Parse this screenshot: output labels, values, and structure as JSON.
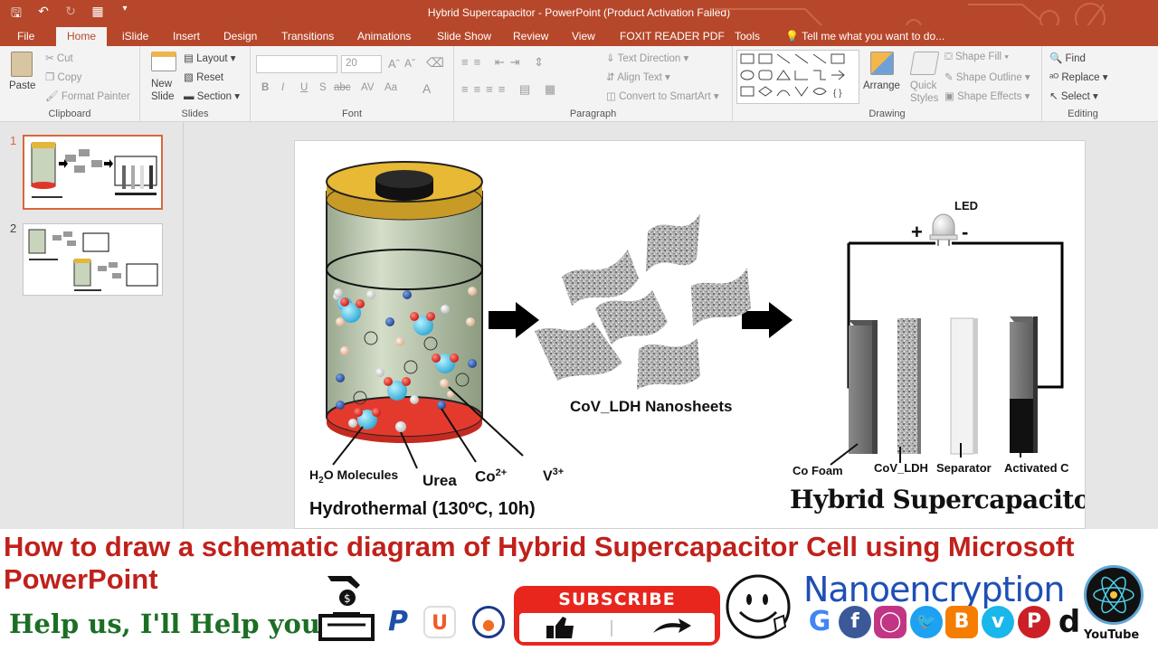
{
  "window": {
    "title": "Hybrid Supercapacitor - PowerPoint (Product Activation Failed)"
  },
  "tabs": [
    {
      "label": "File"
    },
    {
      "label": "Home"
    },
    {
      "label": "iSlide"
    },
    {
      "label": "Insert"
    },
    {
      "label": "Design"
    },
    {
      "label": "Transitions"
    },
    {
      "label": "Animations"
    },
    {
      "label": "Slide Show"
    },
    {
      "label": "Review"
    },
    {
      "label": "View"
    },
    {
      "label": "FOXIT READER PDF"
    },
    {
      "label": "Tools"
    }
  ],
  "tell_me": "Tell me what you want to do...",
  "ribbon": {
    "clipboard": {
      "paste": "Paste",
      "cut": "Cut",
      "copy": "Copy",
      "format_painter": "Format Painter",
      "label": "Clipboard"
    },
    "slides": {
      "new_slide": "New",
      "new_slide2": "Slide",
      "layout": "Layout",
      "reset": "Reset",
      "section": "Section",
      "label": "Slides"
    },
    "font": {
      "font_name": "",
      "font_size": "20",
      "label": "Font",
      "bold": "B",
      "italic": "I",
      "underline": "U",
      "strike": "S",
      "abc": "abc",
      "av": "AV",
      "aa": "Aa",
      "color": "A"
    },
    "paragraph": {
      "text_direction": "Text Direction",
      "align_text": "Align Text",
      "convert_smartart": "Convert to SmartArt",
      "label": "Paragraph"
    },
    "drawing": {
      "arrange": "Arrange",
      "quick_styles": "Quick",
      "quick_styles2": "Styles",
      "shape_fill": "Shape Fill",
      "shape_outline": "Shape Outline",
      "shape_effects": "Shape Effects",
      "label": "Drawing"
    },
    "editing": {
      "find": "Find",
      "replace": "Replace",
      "select": "Select",
      "label": "Editing"
    }
  },
  "thumbnails": [
    {
      "number": "1"
    },
    {
      "number": "2"
    }
  ],
  "slide": {
    "led": "LED",
    "plus": "+",
    "minus": "-",
    "nanosheets": "CoV_LDH Nanosheets",
    "h2o": "H",
    "h2o_sub": "2",
    "h2o_rest": "O Molecules",
    "urea": "Urea",
    "co": "Co",
    "co_sup": "2+",
    "v": "V",
    "v_sup": "3+",
    "hydrothermal": "Hydrothermal (130ºC, 10h)",
    "co_foam": "Co Foam",
    "covldh": "CoV_LDH",
    "separator": "Separator",
    "activated_c": "Activated C",
    "hybrid_title": "Hybrid Supercapacitor"
  },
  "banner": {
    "headline": "How to draw a schematic diagram of Hybrid Supercapacitor Cell using Microsoft PowerPoint",
    "help": "Help us, I'll Help you",
    "subscribe": "SUBSCRIBE",
    "brand": "Nanoencryption",
    "youtube": "YouTube"
  }
}
